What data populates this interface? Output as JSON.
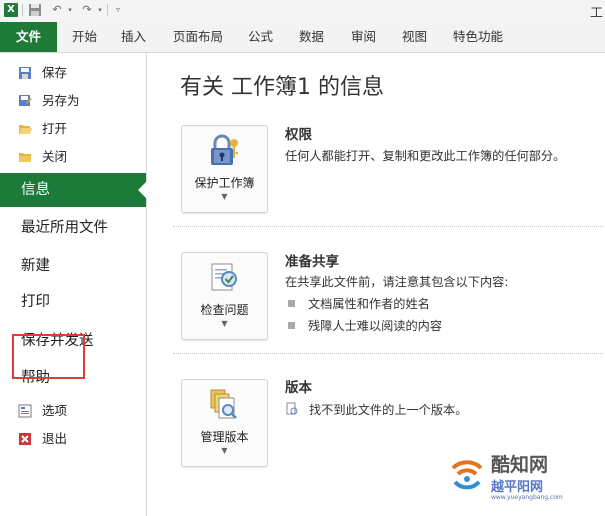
{
  "window": {
    "title_fragment": "工"
  },
  "ribbon": {
    "tabs": [
      {
        "label": "文件"
      },
      {
        "label": "开始"
      },
      {
        "label": "插入"
      },
      {
        "label": "页面布局"
      },
      {
        "label": "公式"
      },
      {
        "label": "数据"
      },
      {
        "label": "审阅"
      },
      {
        "label": "视图"
      },
      {
        "label": "特色功能"
      }
    ]
  },
  "backstage": {
    "small_items": [
      {
        "label": "保存",
        "icon": "save-icon"
      },
      {
        "label": "另存为",
        "icon": "save-as-icon"
      },
      {
        "label": "打开",
        "icon": "open-folder-icon"
      },
      {
        "label": "关闭",
        "icon": "close-folder-icon"
      }
    ],
    "large_items": [
      {
        "label": "信息",
        "selected": true
      },
      {
        "label": "最近所用文件"
      },
      {
        "label": "新建"
      },
      {
        "label": "打印",
        "highlighted": true
      },
      {
        "label": "保存并发送"
      },
      {
        "label": "帮助"
      }
    ],
    "bottom_items": [
      {
        "label": "选项",
        "icon": "options-icon"
      },
      {
        "label": "退出",
        "icon": "exit-icon"
      }
    ]
  },
  "info": {
    "heading": "有关 工作簿1 的信息",
    "sections": [
      {
        "button_label": "保护工作簿",
        "title": "权限",
        "description": "任何人都能打开、复制和更改此工作簿的任何部分。",
        "icon": "lock-key-icon"
      },
      {
        "button_label": "检查问题",
        "title": "准备共享",
        "description": "在共享此文件前，请注意其包含以下内容:",
        "bullets": [
          "文档属性和作者的姓名",
          "残障人士难以阅读的内容"
        ],
        "icon": "inspect-document-icon"
      },
      {
        "button_label": "管理版本",
        "title": "版本",
        "description": "找不到此文件的上一个版本。",
        "icon": "versions-icon"
      }
    ]
  },
  "watermark": {
    "name": "酷知网",
    "sub": "越平阳网",
    "url": "www.yueyangbang.com"
  },
  "colors": {
    "file_tab": "#1e7a37",
    "selected_item": "#1c7b39",
    "highlight_box": "#e03b3b"
  }
}
